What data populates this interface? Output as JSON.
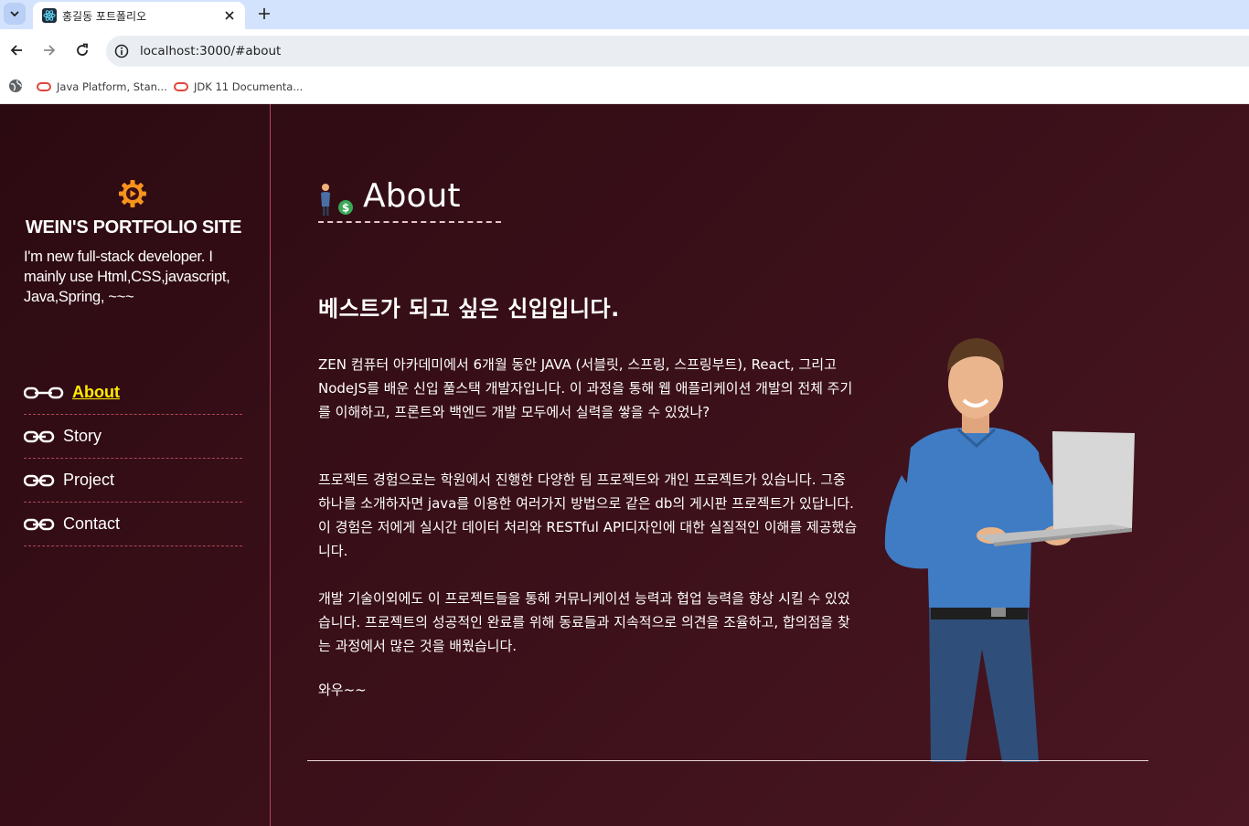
{
  "browser": {
    "tab_title": "홍길동 포트폴리오",
    "url": "localhost:3000/#about",
    "bookmarks": [
      {
        "label": "Java Platform, Stan..."
      },
      {
        "label": "JDK 11 Documenta..."
      }
    ]
  },
  "sidebar": {
    "site_title": "WEIN'S PORTFOLIO SITE",
    "description": "I'm new full-stack developer. I mainly use Html,CSS,javascript, Java,Spring, ~~~",
    "menu": [
      {
        "label": "About",
        "active": true
      },
      {
        "label": "Story",
        "active": false
      },
      {
        "label": "Project",
        "active": false
      },
      {
        "label": "Contact",
        "active": false
      }
    ]
  },
  "content": {
    "section_title": "About",
    "subheading": "베스트가 되고 싶은 신입입니다.",
    "paragraphs": [
      "ZEN 컴퓨터 아카데미에서 6개월 동안 JAVA (서블릿, 스프링, 스프링부트), React, 그리고 NodeJS를 배운 신입 풀스택 개발자입니다. 이 과정을 통해 웹 애플리케이션 개발의 전체 주기를 이해하고, 프론트와 백엔드 개발 모두에서 실력을 쌓을 수 있었나?",
      "프로젝트 경험으로는 학원에서 진행한 다양한 팀 프로젝트와 개인 프로젝트가 있습니다. 그중 하나를 소개하자면 java를 이용한 여러가지 방법으로 같은 db의 게시판 프로젝트가 있답니다. 이 경험은 저에게 실시간 데이터 처리와 RESTful API디자인에 대한 실질적인 이해를 제공했습니다.",
      "개발 기술이외에도 이 프로젝트들을 통해 커뮤니케이션 능력과 협업 능력을 향상 시킬 수 있었습니다. 프로젝트의 성공적인 완료를 위해 동료들과 지속적으로 의견을 조율하고, 합의점을 찾는 과정에서 많은 것을 배웠습니다.",
      "와우~~"
    ]
  },
  "colors": {
    "background": "#3a0f18",
    "accent_active": "#ffec00",
    "divider": "#b2475a",
    "logo_orange": "#f7941d"
  },
  "icons": {
    "logo": "gear-play-icon",
    "menu": "link-chain-icon",
    "about": "businessman-money-icon"
  }
}
